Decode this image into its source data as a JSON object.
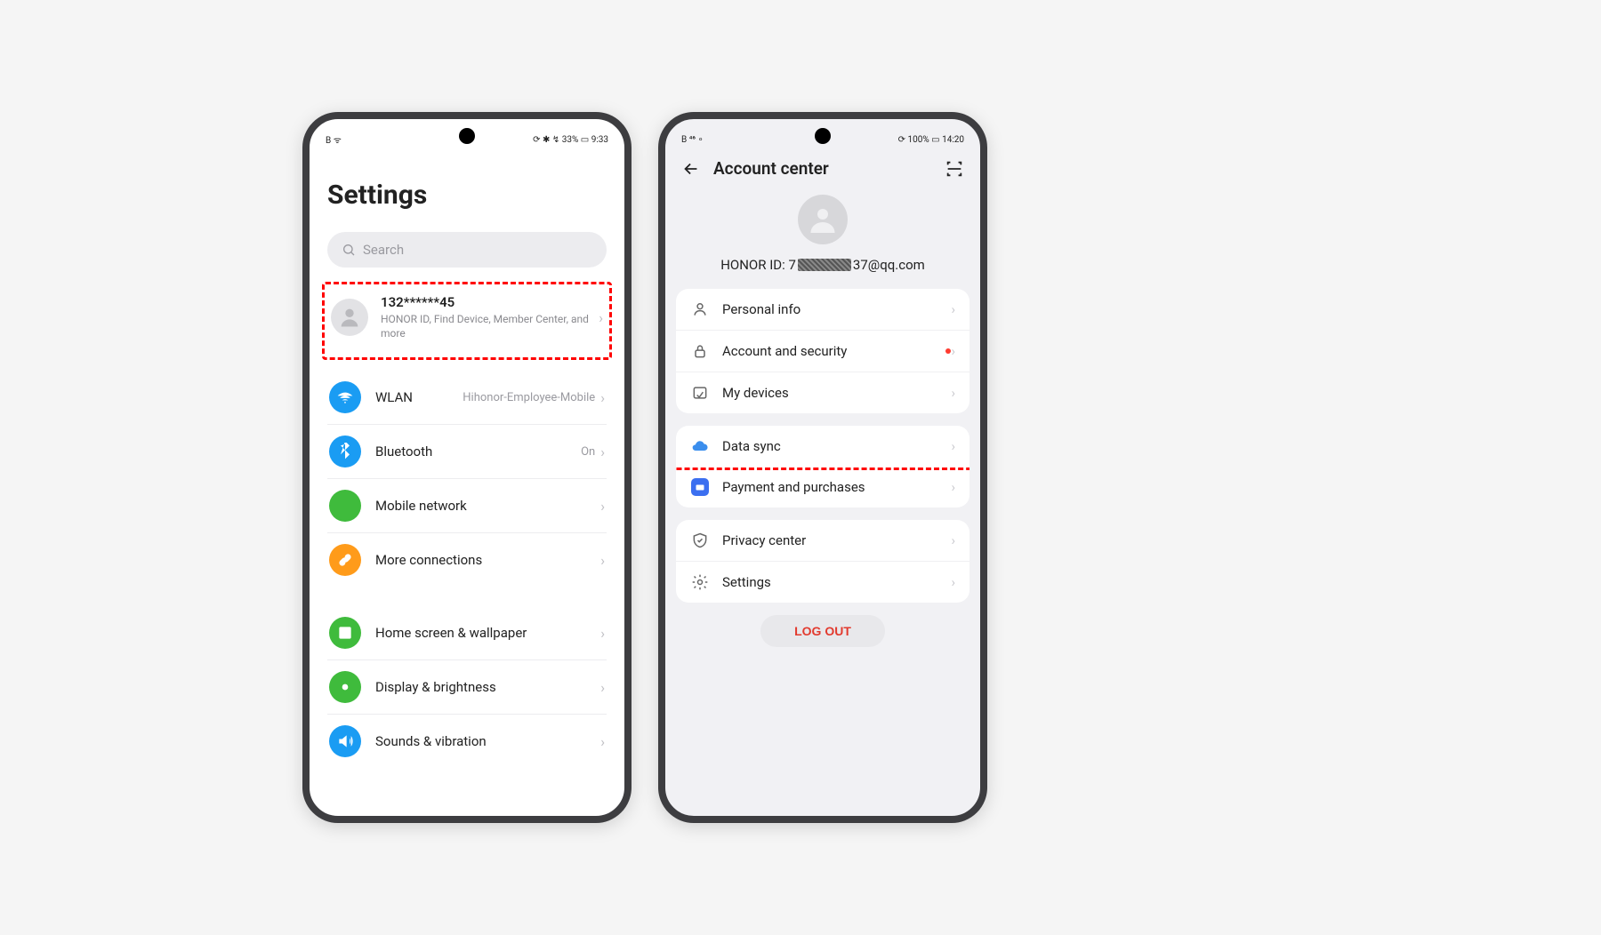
{
  "left": {
    "status": {
      "left_indicators": "B ᯤ",
      "right_indicators": "⟳ ✱ ↯ 33% ▭ 9:33"
    },
    "title": "Settings",
    "search_placeholder": "Search",
    "account": {
      "title": "132******45",
      "subtitle": "HONOR ID, Find Device, Member Center, and more"
    },
    "rows": {
      "wlan": {
        "label": "WLAN",
        "value": "Hihonor-Employee-Mobile"
      },
      "bluetooth": {
        "label": "Bluetooth",
        "value": "On"
      },
      "mobile": {
        "label": "Mobile network"
      },
      "more": {
        "label": "More connections"
      },
      "home": {
        "label": "Home screen & wallpaper"
      },
      "display": {
        "label": "Display & brightness"
      },
      "sound": {
        "label": "Sounds & vibration"
      }
    }
  },
  "right": {
    "status": {
      "left_indicators": "B ⁴⁶ ∘",
      "right_indicators": "⟳ 100% ▭ 14:20"
    },
    "title": "Account center",
    "honor_prefix": "HONOR ID: 7",
    "honor_suffix": "37@qq.com",
    "rows": {
      "personal": "Personal info",
      "security": "Account and security",
      "devices": "My devices",
      "datasync": "Data sync",
      "payment": "Payment and purchases",
      "privacy": "Privacy center",
      "settings": "Settings"
    },
    "logout": "LOG OUT"
  },
  "colors": {
    "blue": "#1a9cf3",
    "green": "#3fbb3c",
    "orange": "#ff9b1a"
  }
}
